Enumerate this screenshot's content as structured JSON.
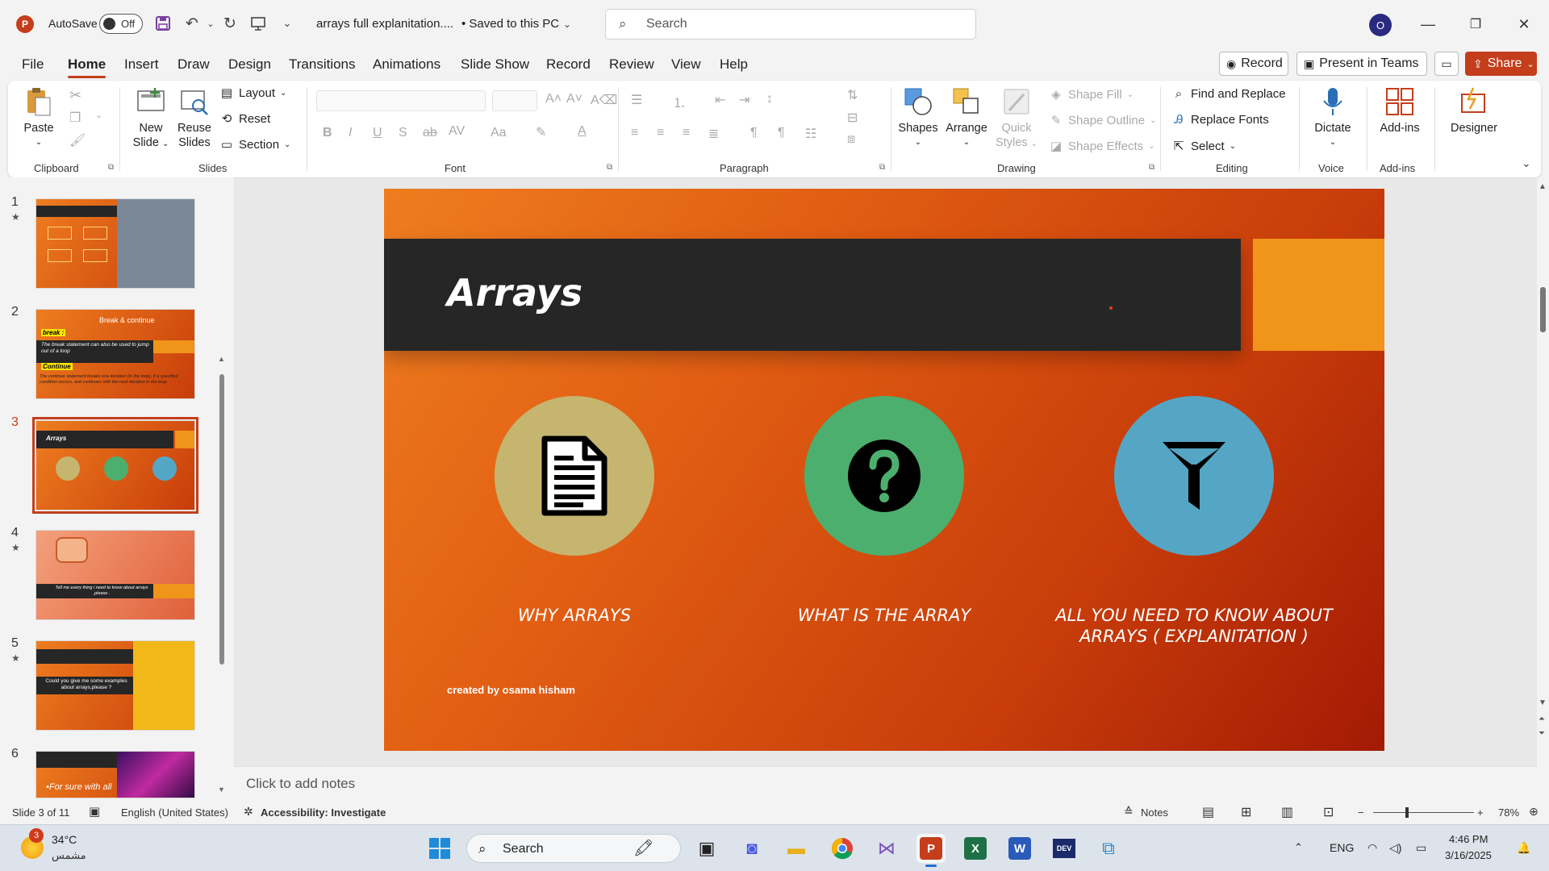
{
  "titlebar": {
    "autosave_label": "AutoSave",
    "autosave_state": "Off",
    "document_title": "arrays full explanitation....",
    "save_status": "• Saved to this PC",
    "search_placeholder": "Search",
    "avatar_initial": "O"
  },
  "menu": {
    "tabs": [
      "File",
      "Home",
      "Insert",
      "Draw",
      "Design",
      "Transitions",
      "Animations",
      "Slide Show",
      "Record",
      "Review",
      "View",
      "Help"
    ],
    "active": "Home",
    "record_button": "Record",
    "present_teams_button": "Present in Teams",
    "share_button": "Share"
  },
  "ribbon": {
    "clipboard": {
      "label": "Clipboard",
      "paste": "Paste"
    },
    "slides": {
      "label": "Slides",
      "new_slide_1": "New",
      "new_slide_2": "Slide",
      "reuse_1": "Reuse",
      "reuse_2": "Slides",
      "layout": "Layout",
      "reset": "Reset",
      "section": "Section"
    },
    "font": {
      "label": "Font"
    },
    "paragraph": {
      "label": "Paragraph"
    },
    "drawing": {
      "label": "Drawing",
      "shapes": "Shapes",
      "arrange": "Arrange",
      "quick_1": "Quick",
      "quick_2": "Styles",
      "shape_fill": "Shape Fill",
      "shape_outline": "Shape Outline",
      "shape_effects": "Shape Effects"
    },
    "editing": {
      "label": "Editing",
      "find_replace": "Find and Replace",
      "replace_fonts": "Replace Fonts",
      "select": "Select"
    },
    "voice": {
      "label": "Voice",
      "dictate": "Dictate"
    },
    "addins": {
      "label": "Add-ins",
      "addins": "Add-ins"
    },
    "designer": {
      "designer": "Designer"
    }
  },
  "thumbnails": {
    "numbers": [
      "1",
      "2",
      "3",
      "4",
      "5",
      "6"
    ],
    "selected": "3",
    "slide2_break": "break :",
    "slide2_title": "Break &  continue",
    "slide2_body1": "The break statement can also be used to jump out of a loop",
    "slide2_continue": "Continue",
    "slide2_body2": "The continue statement breaks one iteration (in the loop), if a specified condition occurs, and continues with the next iteration in the loop.",
    "slide3_title": "Arrays",
    "slide4_text": "Tell me every thing i need to know about arrays ,please .",
    "slide5_text": "Could you give me some examples about arrays,please ?",
    "slide6_text": "•For sure with all"
  },
  "slide": {
    "title": "Arrays",
    "items": [
      {
        "label": "WHY ARRAYS",
        "icon": "document-icon",
        "color": "#c5b56f"
      },
      {
        "label": "WHAT IS THE ARRAY",
        "icon": "question-icon",
        "color": "#4caf6e"
      },
      {
        "label": "ALL YOU NEED TO KNOW ABOUT ARRAYS ( EXPLANITATION )",
        "icon": "filter-icon",
        "color": "#55a6c4"
      }
    ],
    "footer": "created by osama hisham"
  },
  "notes": {
    "placeholder": "Click to add notes"
  },
  "statusbar": {
    "slide_count": "Slide 3 of 11",
    "language": "English (United States)",
    "accessibility": "Accessibility: Investigate",
    "notes": "Notes",
    "zoom": "78%"
  },
  "taskbar": {
    "weather_temp": "34°C",
    "weather_desc": "مشمس",
    "weather_badge": "3",
    "search_placeholder": "Search",
    "language": "ENG",
    "time": "4:46 PM",
    "date": "3/16/2025"
  },
  "colors": {
    "accent": "#c43e1c",
    "slide_band": "#262626",
    "slide_accent": "#f0941a"
  }
}
